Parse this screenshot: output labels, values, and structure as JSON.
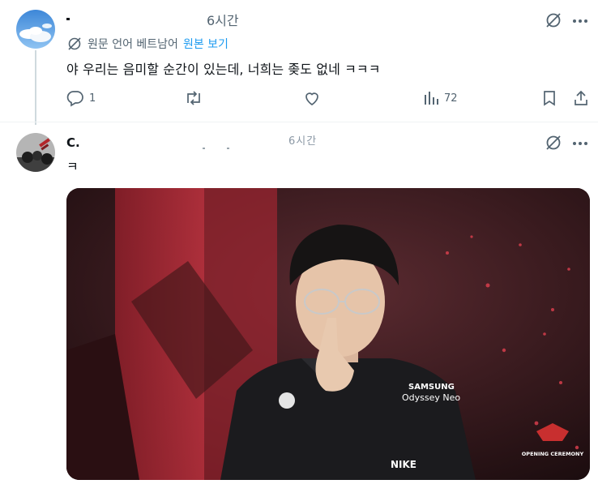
{
  "tweet1": {
    "name": "",
    "time": "6시간",
    "translate_label": "원문 언어 베트남어",
    "show_original": "원본 보기",
    "text": "야 우리는 음미할 순간이 있는데, 너희는 좆도 없네 ㅋㅋㅋ",
    "replies": "1",
    "views": "72"
  },
  "tweet2": {
    "name_stub": "C.",
    "time": "6시간",
    "text": "ㅋ",
    "media": {
      "jersey_line1": "SAMSUNG",
      "jersey_line2": "Odyssey Neo",
      "brand": "NIKE",
      "event_badge_line1": "OPENING CEREMONY"
    }
  },
  "colors": {
    "muted": "#536471",
    "link": "#1d9bf0",
    "thread_line": "#cfd9de"
  },
  "icons": [
    "grok-slash-icon",
    "more-icon",
    "translate-icon",
    "reply-icon",
    "retweet-icon",
    "like-icon",
    "views-icon",
    "bookmark-icon",
    "share-icon"
  ]
}
